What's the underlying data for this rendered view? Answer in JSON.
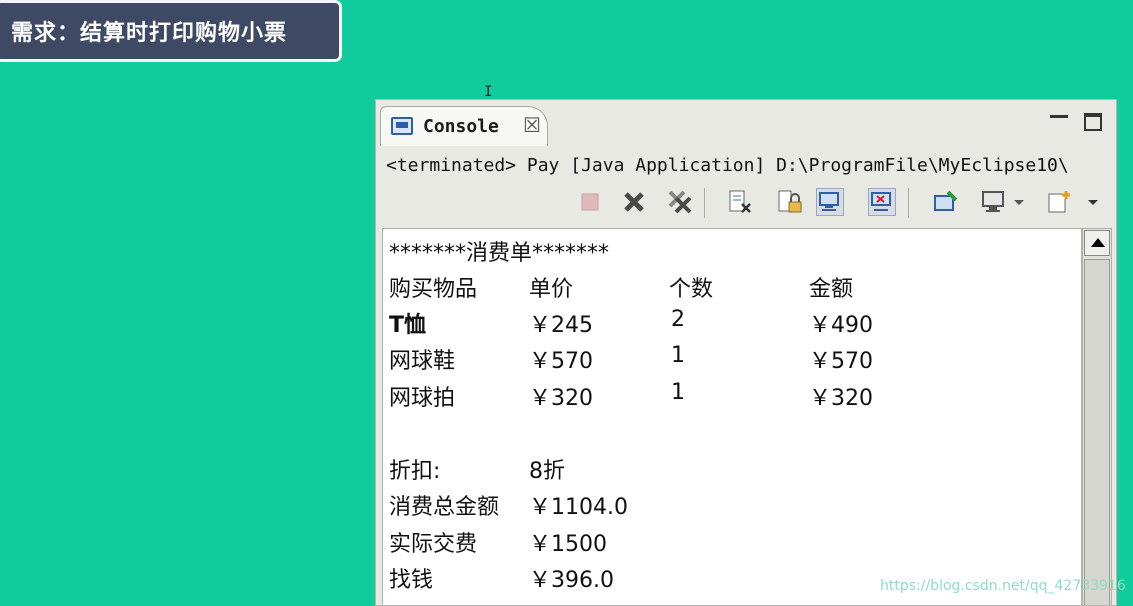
{
  "banner": {
    "title": "需求：结算时打印购物小票"
  },
  "console": {
    "tab_label": "Console",
    "status": "<terminated> Pay [Java Application] D:\\ProgramFile\\MyEclipse10\\",
    "toolbar_icons": [
      "terminate-icon",
      "remove-launch-icon",
      "remove-all-terminated-icon",
      "clear-console-icon",
      "scroll-lock-icon",
      "show-on-stdout-icon",
      "show-on-stderr-icon",
      "pin-console-icon",
      "display-console-icon",
      "open-console-icon"
    ],
    "header_line": "*******消费单*******",
    "table": {
      "columns": [
        "购买物品",
        "单价",
        "个数",
        "金额"
      ],
      "rows": [
        [
          "T恤",
          "￥245",
          "2",
          "￥490"
        ],
        [
          "网球鞋",
          "￥570",
          "1",
          "￥570"
        ],
        [
          "网球拍",
          "￥320",
          "1",
          "￥320"
        ]
      ]
    },
    "summary": [
      [
        "折扣:",
        "8折"
      ],
      [
        "消费总金额",
        "￥1104.0"
      ],
      [
        "实际交费",
        "￥1500"
      ],
      [
        "找钱",
        "￥396.0"
      ]
    ]
  },
  "watermark": "https://blog.csdn.net/qq_42733916"
}
